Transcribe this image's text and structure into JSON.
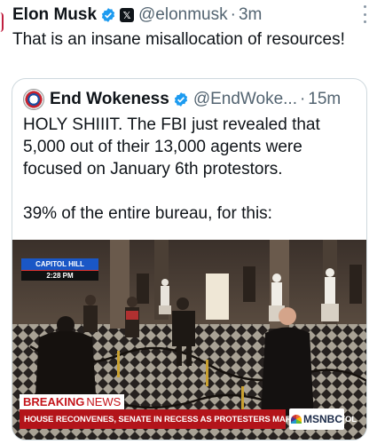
{
  "tweet": {
    "author_name": "Elon Musk",
    "handle": "@elonmusk",
    "separator": "·",
    "time": "3m",
    "text": "That is an insane misallocation of resources!",
    "badge_icon": "verified-badge-icon",
    "affiliation_icon": "x-logo-icon"
  },
  "quote": {
    "author_name": "End Wokeness",
    "handle": "@EndWoke...",
    "separator": "·",
    "time": "15m",
    "lines": [
      "HOLY SHIIIT. The FBI just revealed that",
      "5,000 out of their 13,000 agents were",
      "focused on January 6th protestors.",
      "39% of the entire bureau, for this:"
    ],
    "media": {
      "location_label": "CAPITOL HILL",
      "time_label": "2:28 PM",
      "breaking_label_1": "BREAKING",
      "breaking_label_2": "NEWS",
      "ticker_text": "HOUSE RECONVENES, SENATE IN RECESS AS PROTESTERS MARCH ON CAPITOL",
      "network_label": "MSNBC"
    }
  },
  "colors": {
    "verified_blue": "#1d9bf0",
    "secondary_text": "#536471",
    "breaking_red": "#b3141a"
  }
}
